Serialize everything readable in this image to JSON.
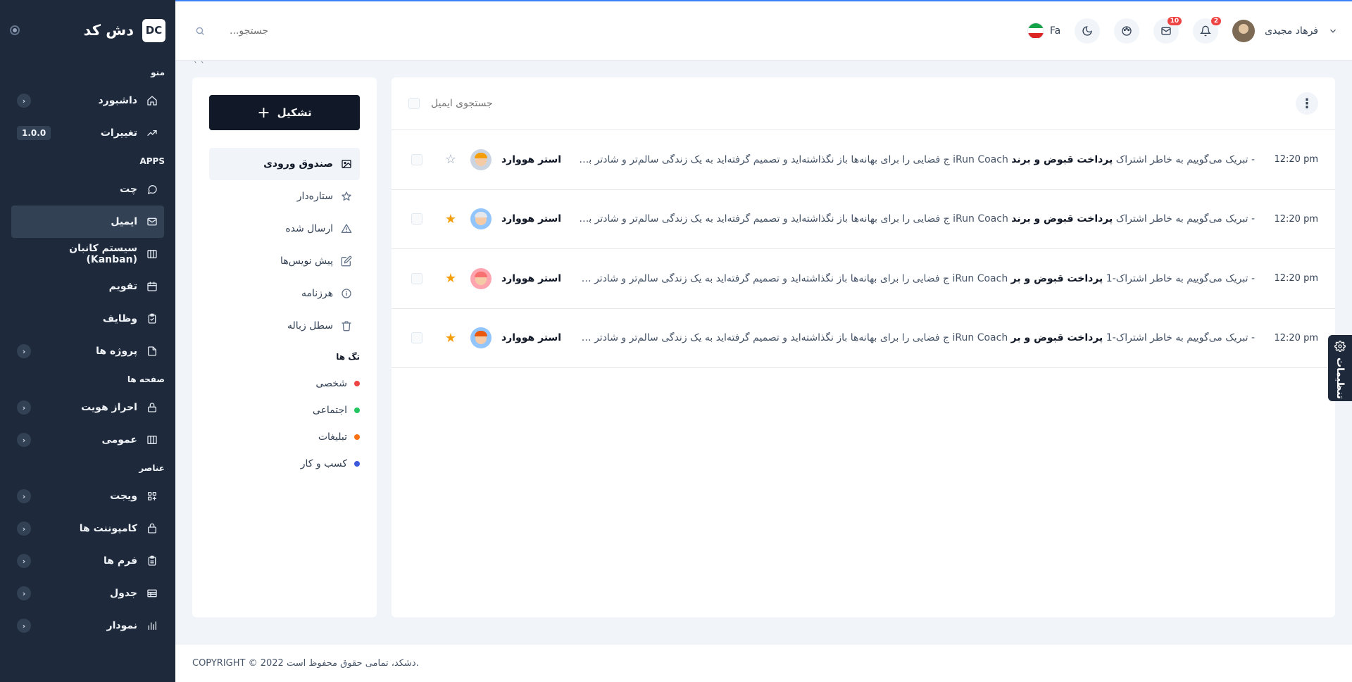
{
  "brand": {
    "logo": "DC",
    "name": "دش کد"
  },
  "sidebar": {
    "sections": [
      {
        "title": "منو",
        "items": [
          {
            "label": "داشبورد",
            "icon": "home-icon",
            "chevron": true
          },
          {
            "label": "تغییرات",
            "icon": "trend-icon",
            "badge": "1.0.0"
          }
        ]
      },
      {
        "title": "APPS",
        "items": [
          {
            "label": "چت",
            "icon": "chat-icon"
          },
          {
            "label": "ایمیل",
            "icon": "mail-icon",
            "active": true
          },
          {
            "label": "سیستم کانبان (Kanban)",
            "icon": "kanban-icon"
          },
          {
            "label": "تقویم",
            "icon": "calendar-icon"
          },
          {
            "label": "وظایف",
            "icon": "tasks-icon"
          },
          {
            "label": "پروژه ها",
            "icon": "file-icon",
            "chevron": true
          }
        ]
      },
      {
        "title": "صفحه ها",
        "items": [
          {
            "label": "احراز هویت",
            "icon": "lock-icon",
            "chevron": true
          },
          {
            "label": "عمومی",
            "icon": "columns-icon",
            "chevron": true
          }
        ]
      },
      {
        "title": "عناصر",
        "items": [
          {
            "label": "ویجت",
            "icon": "widget-icon",
            "chevron": true
          },
          {
            "label": "کامپوننت ها",
            "icon": "bag-icon",
            "chevron": true
          },
          {
            "label": "فرم ها",
            "icon": "form-icon",
            "chevron": true
          },
          {
            "label": "جدول",
            "icon": "table-icon",
            "chevron": true
          },
          {
            "label": "نمودار",
            "icon": "chart-icon",
            "chevron": true
          }
        ]
      }
    ]
  },
  "topbar": {
    "search_placeholder": "جستجو...",
    "lang": "Fa",
    "mail_count": "10",
    "notif_count": "2",
    "user_name": "فرهاد مجیدی"
  },
  "breadcrumb": "` `",
  "left_panel": {
    "compose_label": "تشکیل",
    "folders": [
      {
        "label": "صندوق ورودی",
        "icon": "inbox-icon",
        "active": true
      },
      {
        "label": "ستاره‌دار",
        "icon": "star-icon"
      },
      {
        "label": "ارسال شده",
        "icon": "send-icon"
      },
      {
        "label": "پیش نویس‌ها",
        "icon": "edit-icon"
      },
      {
        "label": "هرزنامه",
        "icon": "info-icon"
      },
      {
        "label": "سطل زباله",
        "icon": "trash-icon"
      }
    ],
    "tags_title": "تگ ها",
    "tags": [
      {
        "label": "شخصی",
        "color": "#ef4444"
      },
      {
        "label": "اجتماعی",
        "color": "#22c55e"
      },
      {
        "label": "تبلیغات",
        "color": "#f97316"
      },
      {
        "label": "کسب و کار",
        "color": "#3b5bdb"
      }
    ]
  },
  "main": {
    "search_placeholder": "جستجوی ایمیل",
    "rows": [
      {
        "sender": "استر هووارد",
        "subject": "پرداخت قبوض و برند",
        "prefix": "iRun Coach",
        "body": "تبریک می‌گوییم به خاطر اشتراک - ",
        "rest": "پرداخت قبوض و برند iRun Coach به یک زندگی سالم‌تر و شادتر برسید",
        "preview": "ج فضایی را برای بهانه‌ها باز نگذاشته‌اید و تصمیم گرفته‌اید به یک زندگی سالم‌تر و شادتر برسید",
        "time": "12:20 pm",
        "starred": false,
        "avatar_bg": "#cbd5e1",
        "hair": "#f59e0b"
      },
      {
        "sender": "استر هووارد",
        "subject": "پرداخت قبوض و برند",
        "prefix": "iRun Coach",
        "preview": "ج فضایی را برای بهانه‌ها باز نگذاشته‌اید و تصمیم گرفته‌اید به یک زندگی سالم‌تر و شادتر برسید",
        "tail": " - تبریک می‌گوییم به خاطر اشتراک",
        "time": "12:20 pm",
        "starred": true,
        "avatar_bg": "#93c5fd",
        "hair": "#e5e7eb"
      },
      {
        "sender": "استر هووارد",
        "subject": "پرداخت قبوض و بر",
        "prefix": "iRun Coach",
        "preview": "ج فضایی را برای بهانه‌ها باز نگذاشته‌اید و تصمیم گرفته‌اید به یک زندگی سالم‌تر و شادتر برسید",
        "tail": " - تبریک می‌گوییم به خاطر اشتراک-1",
        "time": "12:20 pm",
        "starred": true,
        "avatar_bg": "#fda4af",
        "hair": "#f87171"
      },
      {
        "sender": "استر هووارد",
        "subject": "پرداخت قبوض و بر",
        "prefix": "iRun Coach",
        "preview": "ج فضایی را برای بهانه‌ها باز نگذاشته‌اید و تصمیم گرفته‌اید به یک زندگی سالم‌تر و شادتر برسید",
        "tail": " - تبریک می‌گوییم به خاطر اشتراک-1",
        "time": "12:20 pm",
        "starred": true,
        "avatar_bg": "#93c5fd",
        "hair": "#ea580c"
      }
    ]
  },
  "settings_tab": "تنظیمات",
  "footer": "COPYRIGHT © 2022 دشکد، تمامی حقوق محفوظ است."
}
